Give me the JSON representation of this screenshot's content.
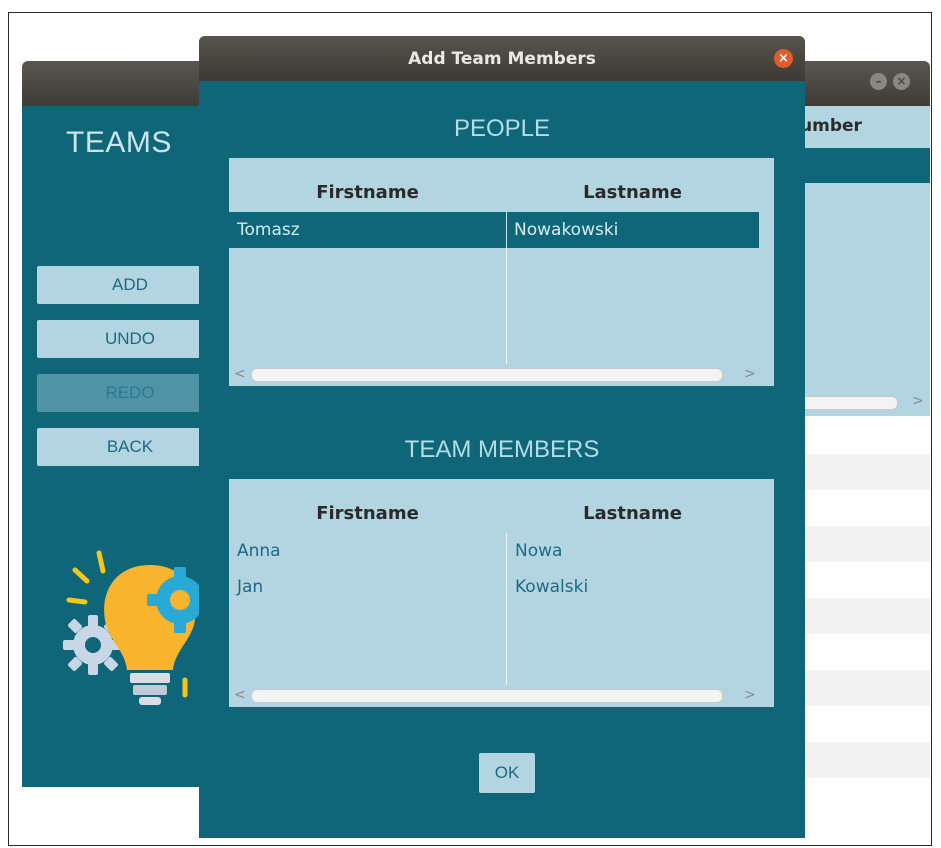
{
  "background_window": {
    "title": "TEAMS",
    "buttons": [
      {
        "label": "ADD",
        "enabled": true
      },
      {
        "label": "UNDO",
        "enabled": true
      },
      {
        "label": "REDO",
        "enabled": false
      },
      {
        "label": "BACK",
        "enabled": true
      }
    ],
    "right_table_header_visible": "umber",
    "right_scroll_arrow": ">",
    "illustration": "lightbulb-gears-icon"
  },
  "dialog": {
    "title": "Add Team Members",
    "close_icon": "close-icon",
    "people": {
      "heading": "PEOPLE",
      "columns": [
        "Firstname",
        "Lastname"
      ],
      "rows": [
        {
          "firstname": "Tomasz",
          "lastname": "Nowakowski",
          "selected": true
        }
      ],
      "scroll_left": "<",
      "scroll_right": ">"
    },
    "team_members": {
      "heading": "TEAM MEMBERS",
      "columns": [
        "Firstname",
        "Lastname"
      ],
      "rows": [
        {
          "firstname": "Anna",
          "lastname": "Nowa"
        },
        {
          "firstname": "Jan",
          "lastname": "Kowalski"
        }
      ],
      "scroll_left": "<",
      "scroll_right": ">"
    },
    "ok_label": "OK"
  },
  "colors": {
    "teal": "#0e6678",
    "light_blue": "#b3d5e1",
    "titlebar": "#45423c",
    "close_red": "#e25b2e"
  }
}
